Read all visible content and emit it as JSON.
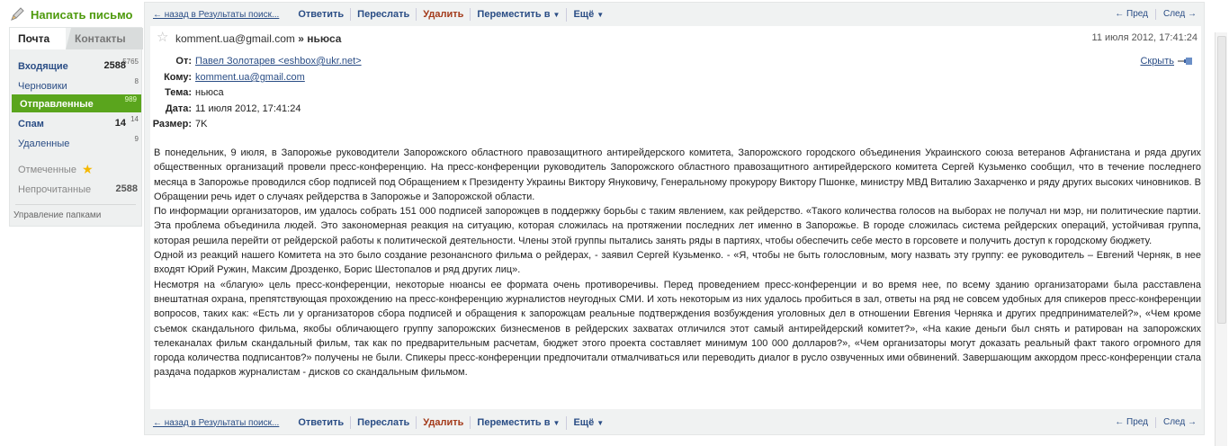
{
  "sidebar": {
    "compose_label": "Написать письмо",
    "tabs": {
      "mail": "Почта",
      "contacts": "Контакты"
    },
    "folders": [
      {
        "name": "Входящие",
        "unread": "2588",
        "total": "5765"
      },
      {
        "name": "Черновики",
        "unread": "",
        "total": "8"
      },
      {
        "name": "Отправленные",
        "unread": "",
        "total": "989"
      },
      {
        "name": "Спам",
        "unread": "14",
        "total": "14"
      },
      {
        "name": "Удаленные",
        "unread": "",
        "total": "9"
      }
    ],
    "flagged": "Отмеченные",
    "unread_label": "Непрочитанные",
    "unread_count": "2588",
    "manage_folders": "Управление папками"
  },
  "toolbar": {
    "back": "← назад в Результаты поиск...",
    "reply": "Ответить",
    "forward": "Переслать",
    "delete": "Удалить",
    "move": "Переместить в",
    "more": "Ещё",
    "prev": "← Пред",
    "next": "След →"
  },
  "message": {
    "from_short": "komment.ua@gmail.com",
    "subject_short": "» ньюса",
    "date_short": "11 июля 2012, 17:41:24",
    "headers": {
      "from_label": "От:",
      "from_value": "Павел Золотарев <eshbox@ukr.net>",
      "to_label": "Кому:",
      "to_value": "komment.ua@gmail.com",
      "subject_label": "Тема:",
      "subject_value": "ньюса",
      "date_label": "Дата:",
      "date_value": "11 июля 2012, 17:41:24",
      "size_label": "Размер:",
      "size_value": "7K"
    },
    "hide_label": "Скрыть",
    "body": [
      "В понедельник, 9 июля, в Запорожье руководители Запорожского областного правозащитного антирейдерского комитета, Запорожского городского объединения Украинского союза ветеранов Афганистана и ряда других общественных организаций провели пресс-конференцию. На пресс-конференции руководитель Запорожского областного правозащитного антирейдерского комитета Сергей Кузьменко сообщил, что в течение последнего месяца в Запорожье проводился сбор подписей под Обращением к Президенту Украины Виктору Януковичу, Генеральному прокурору Виктору Пшонке, министру МВД Виталию Захарченко и ряду других высоких чиновников. В Обращении речь идет о случаях рейдерства в Запорожье и Запорожской области.",
      "По информации организаторов, им удалось собрать 151 000 подписей запорожцев в поддержку борьбы с таким явлением, как рейдерство. «Такого количества голосов на выборах не получал ни мэр, ни политические партии. Эта проблема объединила людей. Это закономерная реакция на ситуацию, которая сложилась на протяжении последних лет именно в Запорожье. В городе сложилась система рейдерских операций, устойчивая группа, которая решила перейти от рейдерской работы к политической деятельности. Члены этой группы пытались занять ряды в партиях, чтобы обеспечить себе место в горсовете и получить доступ к городскому бюджету.",
      "Одной из реакций нашего Комитета на это было создание резонансного фильма о рейдерах, - заявил Сергей Кузьменко. - «Я, чтобы не быть голословным, могу назвать эту группу: ее руководитель – Евгений Черняк, в нее входят Юрий Ружин, Максим Дрозденко, Борис Шестопалов и ряд других лиц».",
      "Несмотря на «благую» цель пресс-конференции, некоторые нюансы ее формата очень противоречивы. Перед проведением пресс-конференции и во время нее, по всему зданию организаторами была расставлена внештатная охрана, препятствующая прохождению на пресс-конференцию журналистов неугодных СМИ. И хоть некоторым из них удалось пробиться в зал, ответы на ряд не совсем удобных для спикеров пресс-конференции вопросов, таких как: «Есть ли у организаторов сбора подписей и обращения к запорожцам реальные подтверждения возбуждения уголовных дел в отношении Евгения Черняка и других предпринимателей?», «Чем кроме съемок скандального фильма, якобы обличающего группу запорожских бизнесменов в рейдерских захватах отличился этот самый антирейдерский комитет?», «На какие деньги был снять и ратирован на запорожских телеканалах фильм скандальный фильм, так как по предварительным расчетам, бюджет этого проекта составляет минимум 100 000 долларов?», «Чем организаторы могут доказать реальный факт такого огромного для города количества подписантов?» получены не были. Спикеры пресс-конференции предпочитали отмалчиваться или переводить диалог в русло озвученных ими обвинений. Завершающим аккордом пресс-конференции стала раздача подарков журналистам - дисков со скандальным фильмом."
    ]
  },
  "colors": {
    "accent_green": "#5aa51d",
    "link_blue": "#2a4d85",
    "delete_red": "#a33a1a"
  },
  "icons": {
    "compose": "pen-icon",
    "star": "star-icon",
    "pin": "pin-icon"
  }
}
